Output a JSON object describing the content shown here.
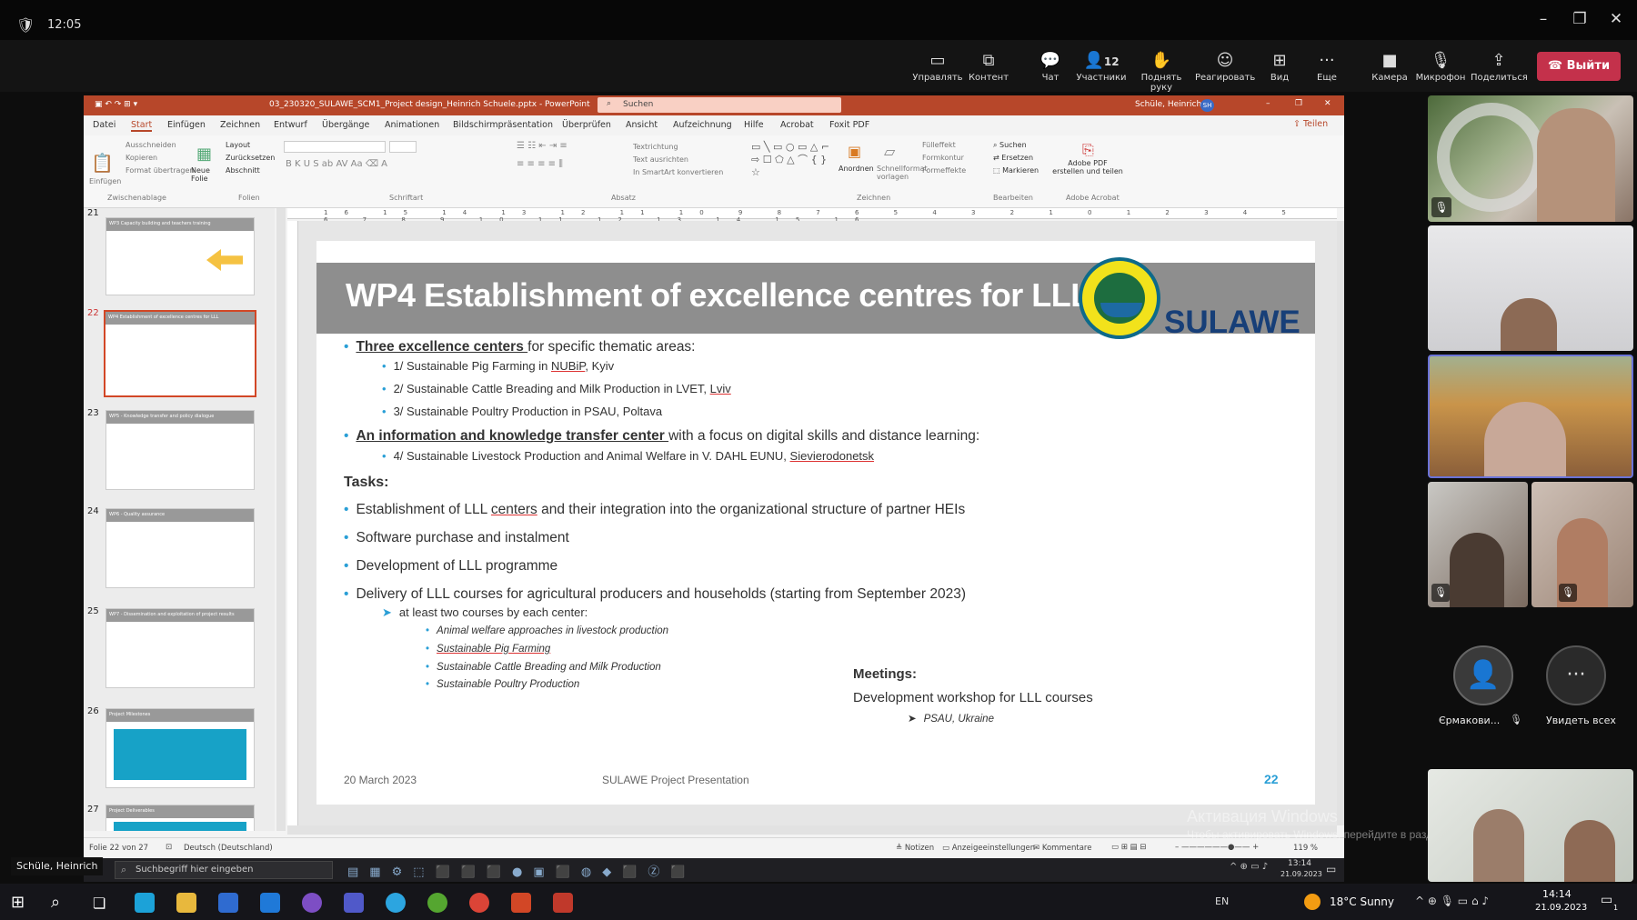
{
  "meeting": {
    "time": "12:05",
    "toolbar": [
      {
        "id": "manage",
        "label": "Управлять",
        "icon": "▭"
      },
      {
        "id": "content",
        "label": "Контент",
        "icon": "⧉"
      },
      {
        "id": "chat",
        "label": "Чат",
        "icon": "💬"
      },
      {
        "id": "participants",
        "label": "Участники",
        "icon": "👤",
        "count": "12"
      },
      {
        "id": "raise-hand",
        "label": "Поднять руку",
        "icon": "✋"
      },
      {
        "id": "react",
        "label": "Реагировать",
        "icon": "☺"
      },
      {
        "id": "view",
        "label": "Вид",
        "icon": "⊞"
      },
      {
        "id": "more",
        "label": "Еще",
        "icon": "···"
      },
      {
        "id": "camera",
        "label": "Камера",
        "icon": "■"
      },
      {
        "id": "mic",
        "label": "Микрофон",
        "icon": "🎙"
      },
      {
        "id": "share",
        "label": "Поделиться",
        "icon": "⇪"
      }
    ],
    "leave_label": "Выйти",
    "presenter_label": "Schüle, Heinrich",
    "participants_tiles": {
      "ermakovi_name": "Єрмакови...",
      "see_all": "Увидеть всех"
    }
  },
  "ppt": {
    "window_title": "03_230320_SULAWE_SCM1_Project design_Heinrich Schuele.pptx - PowerPoint",
    "search_placeholder": "Suchen",
    "user": "Schüle, Heinrich",
    "user_initials": "SH",
    "share": "Teilen",
    "menu": [
      "Datei",
      "Start",
      "Einfügen",
      "Zeichnen",
      "Entwurf",
      "Übergänge",
      "Animationen",
      "Bildschirmpräsentation",
      "Überprüfen",
      "Ansicht",
      "Aufzeichnung",
      "Hilfe",
      "Acrobat",
      "Foxit PDF"
    ],
    "ribbon_groups": [
      "Zwischenablage",
      "Folien",
      "Schriftart",
      "Absatz",
      "Zeichnen",
      "Bearbeiten",
      "Adobe Acrobat"
    ],
    "ribbon_items": {
      "clip": [
        "Ausschneiden",
        "Kopieren",
        "Format übertragen"
      ],
      "paste": "Einfügen",
      "new_slide": "Neue Folie",
      "slides": [
        "Layout",
        "Zurücksetzen",
        "Abschnitt"
      ],
      "paragraph": [
        "Textrichtung",
        "Text ausrichten",
        "In SmartArt konvertieren"
      ],
      "arrange": "Anordnen",
      "quick_styles": "Schnellformat-vorlagen",
      "fill": [
        "Fülleffekt",
        "Formkontur",
        "Formeffekte"
      ],
      "edit": [
        "Suchen",
        "Ersetzen",
        "Markieren"
      ],
      "adobe": "Adobe PDF erstellen und teilen"
    },
    "thumbs": [
      {
        "n": "21",
        "title": "WP3 Capacity building and teachers training"
      },
      {
        "n": "22",
        "title": "WP4 Establishment of excellence centres for LLL"
      },
      {
        "n": "23",
        "title": "WP5 - Knowledge transfer and policy dialogue"
      },
      {
        "n": "24",
        "title": "WP6 - Quality assurance"
      },
      {
        "n": "25",
        "title": "WP7 - Dissemination and exploitation of project results"
      },
      {
        "n": "26",
        "title": "Project Milestones"
      },
      {
        "n": "27",
        "title": "Project Deliverables"
      }
    ],
    "status": {
      "slide_of": "Folie 22 von 27",
      "language": "Deutsch (Deutschland)",
      "notes": "Notizen",
      "display": "Anzeigeeinstellungen",
      "comments": "Kommentare",
      "zoom": "119 %"
    }
  },
  "slide": {
    "title": "WP4 Establishment of excellence centres for LLL",
    "logo_text": "SULAWE",
    "b1": {
      "u": "Three excellence centers ",
      "rest": "for specific thematic areas:"
    },
    "b1_items": [
      {
        "pre": "1/ Sustainable Pig Farming in ",
        "red": "NUBiP",
        "post": ", Kyiv"
      },
      {
        "pre": "2/ Sustainable Cattle Breading and Milk Production in LVET, ",
        "red": "Lviv",
        "post": ""
      },
      {
        "pre": "3/ Sustainable Poultry Production in PSAU, Poltava",
        "red": "",
        "post": ""
      }
    ],
    "b2": {
      "u": "An information and knowledge transfer center ",
      "rest": "with a focus on digital skills and distance learning:"
    },
    "b2_item": {
      "pre": "4/ Sustainable Livestock Production and Animal Welfare in V. DAHL EUNU, ",
      "red": "Sievierodonetsk",
      "post": ""
    },
    "tasks_heading": "Tasks:",
    "tasks": [
      {
        "pre": "Establishment of LLL ",
        "red": "centers",
        "post": " and their integration into the organizational structure of partner HEIs"
      },
      {
        "pre": "Software purchase and instalment",
        "red": "",
        "post": ""
      },
      {
        "pre": "Development of LLL programme",
        "red": "",
        "post": ""
      },
      {
        "pre": "Delivery of LLL courses for agricultural producers and households (starting from September 2023)",
        "red": "",
        "post": ""
      }
    ],
    "sub_task": "at least two courses by each center:",
    "courses": [
      "Animal welfare approaches in livestock production",
      "Sustainable Pig Farming",
      "Sustainable Cattle Breading and Milk Production",
      "Sustainable Poultry Production"
    ],
    "meetings_heading": "Meetings:",
    "meetings_item": "Development workshop for LLL courses",
    "meetings_sub": "PSAU, Ukraine",
    "footer_date": "20 March 2023",
    "footer_center": "SULAWE Project Presentation",
    "page_no": "22"
  },
  "watermark": {
    "line1": "Активация Windows",
    "line2": "Чтобы активировать Windows, перейдите в раздел \"Параметры\"."
  },
  "vm_taskbar": {
    "search_placeholder": "Suchbegriff hier eingeben",
    "time": "13:14",
    "date": "21.09.2023"
  },
  "taskbar": {
    "lang": "EN",
    "weather": "18°C  Sunny",
    "time": "14:14",
    "date": "21.09.2023",
    "notif_count": "1"
  }
}
